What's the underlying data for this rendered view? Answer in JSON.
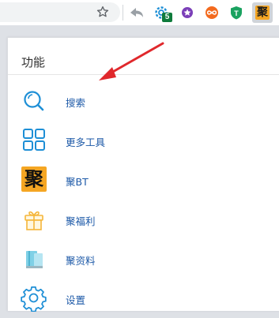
{
  "toolbar": {
    "extensions": [
      {
        "name": "back-arrow-extension"
      },
      {
        "name": "gear-extension",
        "badge": "5"
      },
      {
        "name": "purple-star-extension"
      },
      {
        "name": "infinity-extension"
      },
      {
        "name": "green-shield-extension"
      },
      {
        "name": "ju-extension",
        "glyph": "聚"
      }
    ]
  },
  "popup": {
    "section_title": "功能",
    "items": [
      {
        "label": "搜索",
        "icon": "search-icon"
      },
      {
        "label": "更多工具",
        "icon": "grid-icon"
      },
      {
        "label": "聚BT",
        "icon": "ju-logo-icon",
        "glyph": "聚"
      },
      {
        "label": "聚福利",
        "icon": "gift-icon"
      },
      {
        "label": "聚资料",
        "icon": "books-icon"
      },
      {
        "label": "设置",
        "icon": "gear-icon"
      }
    ]
  },
  "colors": {
    "accent": "#1e8fd6",
    "label": "#1e5aa8",
    "arrow": "#e0282c",
    "ju_orange": "#f5a623"
  }
}
